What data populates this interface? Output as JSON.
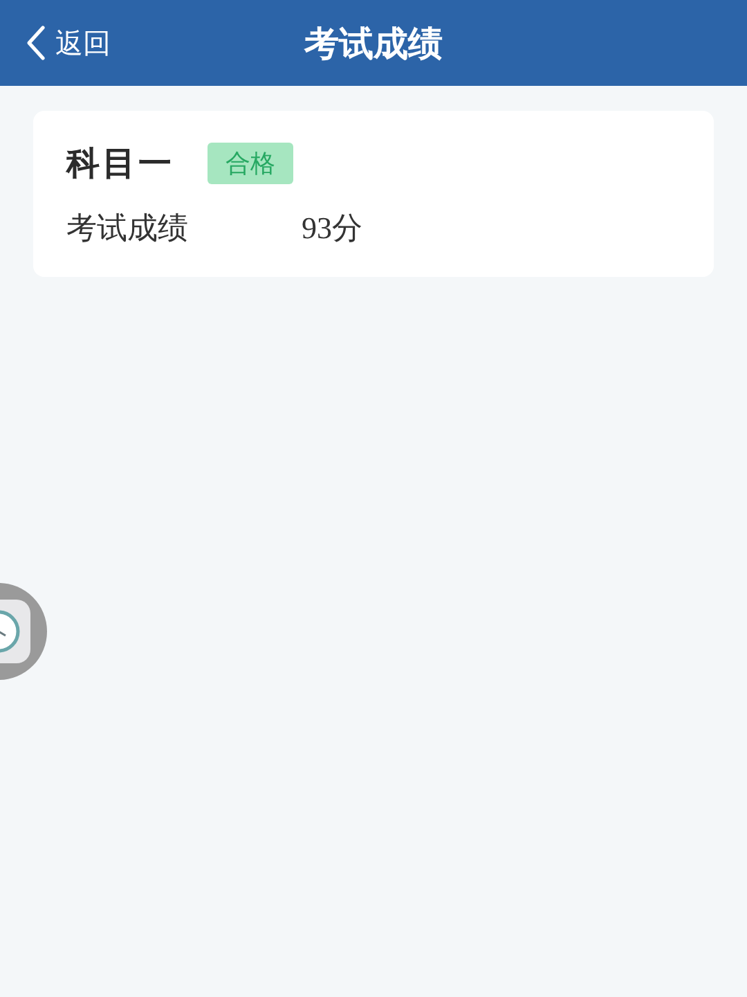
{
  "nav_bar": {
    "back": "返回",
    "title": "考试成绩"
  },
  "results": [
    {
      "subject": "科目一",
      "status": {
        "text": "合格",
        "kind": "pass"
      },
      "label": "考试成绩",
      "score": "93分"
    }
  ]
}
